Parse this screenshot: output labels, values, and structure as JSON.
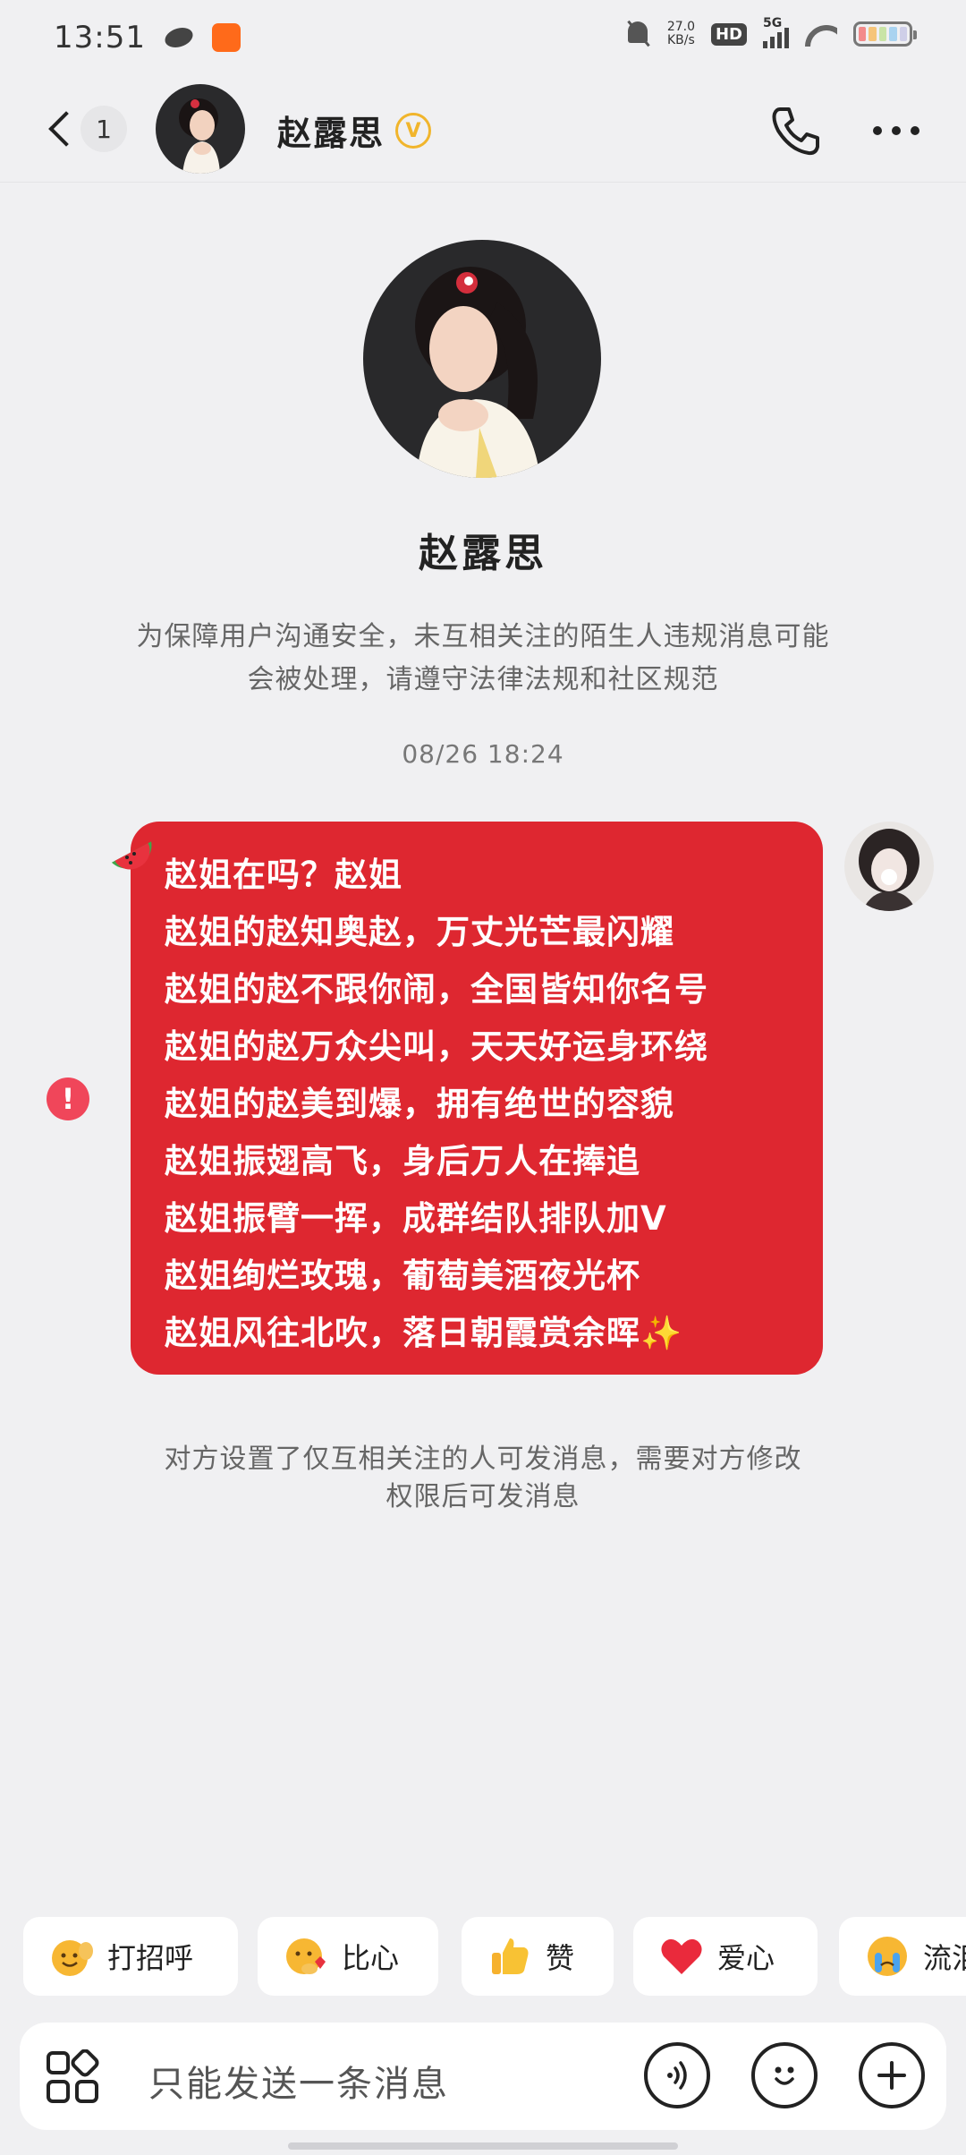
{
  "status_bar": {
    "time": "13:51",
    "speed_value": "27.0",
    "speed_unit": "KB/s",
    "hd": "HD",
    "network": "5G"
  },
  "header": {
    "unread_count": "1",
    "contact_name": "赵露思",
    "verify_mark": "V"
  },
  "profile": {
    "name": "赵露思",
    "notice": "为保障用户沟通安全，未互相关注的陌生人违规消息可能会被处理，请遵守法律法规和社区规范"
  },
  "conversation": {
    "timestamp": "08/26 18:24",
    "message_lines": [
      "赵姐在吗？赵姐",
      "赵姐的赵知奥赵，万丈光芒最闪耀",
      "赵姐的赵不跟你闹，全国皆知你名号",
      "赵姐的赵万众尖叫，天天好运身环绕",
      "赵姐的赵美到爆，拥有绝世的容貌",
      "赵姐振翅高飞，身后万人在捧追",
      "赵姐振臂一挥，成群结队排队加V",
      "赵姐绚烂玫瑰，葡萄美酒夜光杯",
      "赵姐风往北吹，落日朝霞赏余晖✨"
    ],
    "error_mark": "!",
    "system_note": "对方设置了仅互相关注的人可发消息，需要对方修改权限后可发消息",
    "bubble_color": "#de2730"
  },
  "quick_replies": [
    {
      "label": "打招呼",
      "icon": "wave-emoji-icon"
    },
    {
      "label": "比心",
      "icon": "finger-heart-emoji-icon"
    },
    {
      "label": "赞",
      "icon": "thumbs-up-emoji-icon"
    },
    {
      "label": "爱心",
      "icon": "heart-emoji-icon"
    },
    {
      "label": "流泪",
      "icon": "crying-emoji-icon"
    }
  ],
  "input": {
    "placeholder": "只能发送一条消息"
  }
}
